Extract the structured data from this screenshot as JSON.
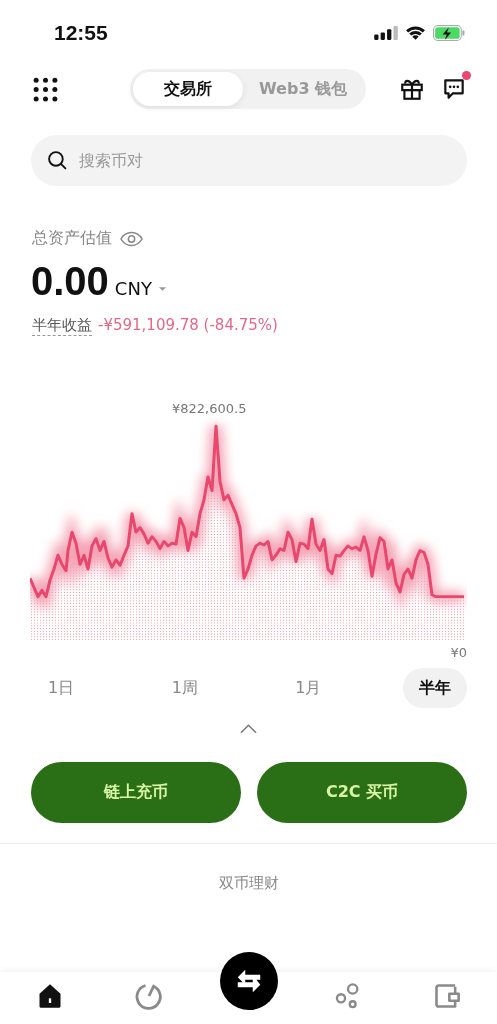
{
  "status_bar": {
    "time": "12:55"
  },
  "header": {
    "tabs": [
      {
        "label": "交易所",
        "selected": true
      },
      {
        "label": "Web3 钱包",
        "selected": false
      }
    ],
    "messages_unread": true
  },
  "search": {
    "placeholder": "搜索币对"
  },
  "assets": {
    "title": "总资产估值",
    "amount": "0.00",
    "currency": "CNY",
    "gain_label": "半年收益",
    "gain_value": "-¥591,109.78 (-84.75%)"
  },
  "chart": {
    "max_label": "¥822,600.5",
    "min_label": "¥0"
  },
  "periods": [
    {
      "label": "1日",
      "selected": false
    },
    {
      "label": "1周",
      "selected": false
    },
    {
      "label": "1月",
      "selected": false
    },
    {
      "label": "半年",
      "selected": true
    }
  ],
  "actions": [
    {
      "label": "链上充币"
    },
    {
      "label": "C2C 买币"
    }
  ],
  "section_title": "双币理财",
  "nav": [
    {
      "kind": "home",
      "selected": true
    },
    {
      "kind": "discover",
      "selected": false
    },
    {
      "kind": "trade"
    },
    {
      "kind": "finance",
      "selected": false
    },
    {
      "kind": "wallet",
      "selected": false
    }
  ]
}
